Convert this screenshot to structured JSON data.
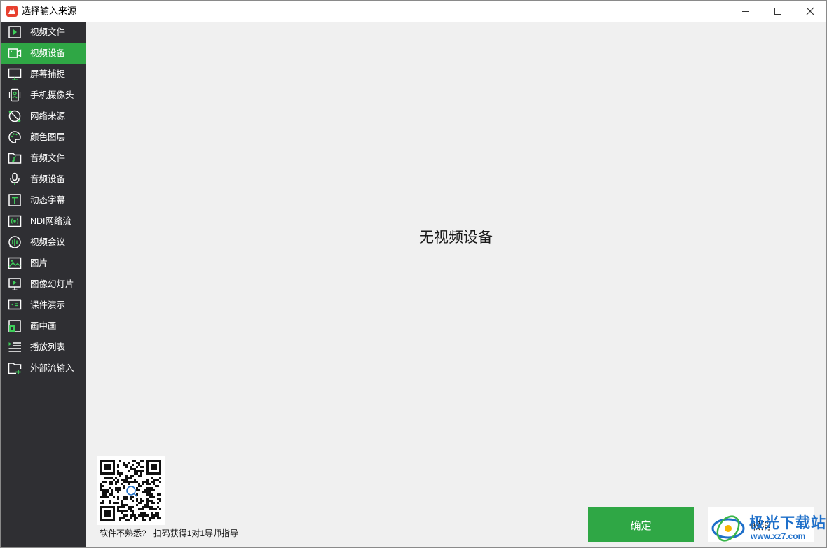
{
  "window": {
    "title": "选择输入来源",
    "controls": {
      "minimize": "minimize-icon",
      "maximize": "maximize-icon",
      "close": "close-icon"
    }
  },
  "sidebar": {
    "active_index": 1,
    "items": [
      {
        "label": "视频文件",
        "icon": "video-file-icon"
      },
      {
        "label": "视频设备",
        "icon": "video-device-icon"
      },
      {
        "label": "屏幕捕捉",
        "icon": "screen-capture-icon"
      },
      {
        "label": "手机摄像头",
        "icon": "phone-camera-icon"
      },
      {
        "label": "网络来源",
        "icon": "network-source-icon"
      },
      {
        "label": "颜色图层",
        "icon": "color-layer-icon"
      },
      {
        "label": "音频文件",
        "icon": "audio-file-icon"
      },
      {
        "label": "音频设备",
        "icon": "microphone-icon"
      },
      {
        "label": "动态字幕",
        "icon": "text-icon"
      },
      {
        "label": "NDI网络流",
        "icon": "ndi-stream-icon"
      },
      {
        "label": "视频会议",
        "icon": "video-conference-icon"
      },
      {
        "label": "图片",
        "icon": "image-icon"
      },
      {
        "label": "图像幻灯片",
        "icon": "slideshow-icon"
      },
      {
        "label": "课件演示",
        "icon": "presentation-icon"
      },
      {
        "label": "画中画",
        "icon": "picture-in-picture-icon"
      },
      {
        "label": "播放列表",
        "icon": "playlist-icon"
      },
      {
        "label": "外部流输入",
        "icon": "external-stream-icon"
      }
    ]
  },
  "main": {
    "message": "无视频设备"
  },
  "help": {
    "caption_left": "软件不熟悉?",
    "caption_right": "扫码获得1对1导师指导"
  },
  "buttons": {
    "ok": "确定",
    "cancel": "取消"
  },
  "watermark": {
    "text": "极光下载站",
    "url": "www.xz7.com"
  },
  "colors": {
    "accent": "#2fa745",
    "sidebar_bg": "#2f2f33",
    "content_bg": "#f0f0f0",
    "watermark": "#1e6fc9"
  }
}
